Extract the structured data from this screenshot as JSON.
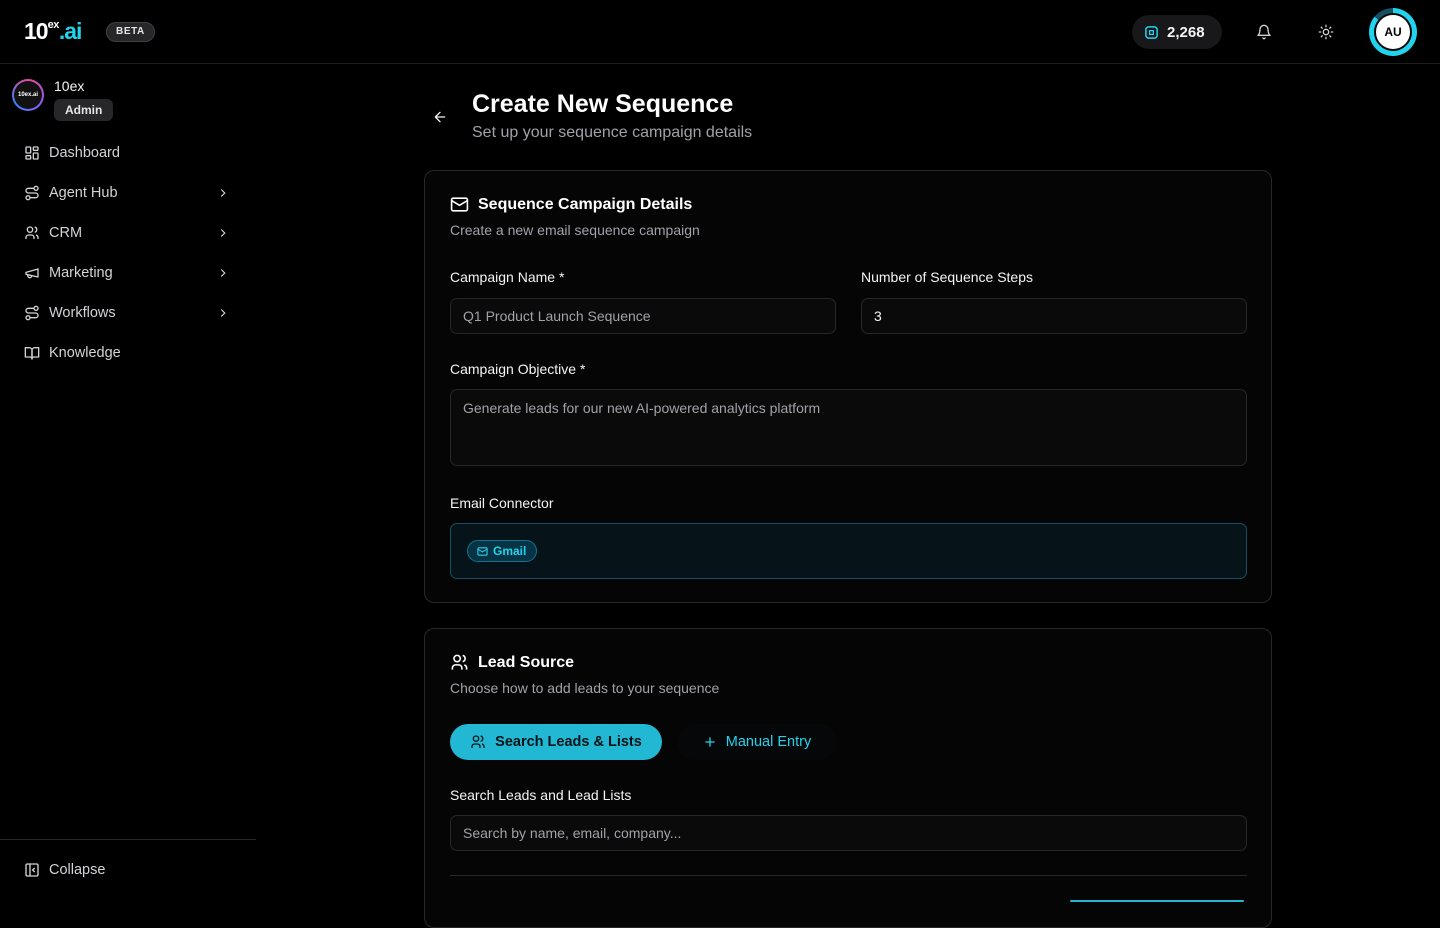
{
  "header": {
    "logo_main": "10",
    "logo_sup": "ex",
    "logo_suffix": ".ai",
    "beta_badge": "BETA",
    "credits": "2,268",
    "icons": [
      "coin-icon",
      "bell-icon",
      "sun-icon"
    ],
    "avatar_initials": "AU"
  },
  "sidebar": {
    "org_logo_text": "10ex.ai",
    "org_name": "10ex",
    "org_role": "Admin",
    "items": [
      {
        "label": "Dashboard",
        "icon": "grid-icon",
        "has_children": false
      },
      {
        "label": "Agent Hub",
        "icon": "route-icon",
        "has_children": true
      },
      {
        "label": "CRM",
        "icon": "users-icon",
        "has_children": true
      },
      {
        "label": "Marketing",
        "icon": "megaphone-icon",
        "has_children": true
      },
      {
        "label": "Workflows",
        "icon": "workflow-icon",
        "has_children": true
      },
      {
        "label": "Knowledge",
        "icon": "book-icon",
        "has_children": false
      }
    ],
    "collapse_label": "Collapse"
  },
  "page": {
    "title": "Create New Sequence",
    "subtitle": "Set up your sequence campaign details"
  },
  "details_card": {
    "title": "Sequence Campaign Details",
    "subtitle": "Create a new email sequence campaign",
    "campaign_name_label": "Campaign Name *",
    "campaign_name_placeholder": "Q1 Product Launch Sequence",
    "steps_label": "Number of Sequence Steps",
    "steps_value": "3",
    "objective_label": "Campaign Objective *",
    "objective_placeholder": "Generate leads for our new AI-powered analytics platform",
    "connector_label": "Email Connector",
    "connector_chip": "Gmail"
  },
  "lead_card": {
    "title": "Lead Source",
    "subtitle": "Choose how to add leads to your sequence",
    "search_button": "Search Leads & Lists",
    "manual_button": "Manual Entry",
    "search_label": "Search Leads and Lead Lists",
    "search_placeholder": "Search by name, email, company..."
  },
  "colors": {
    "accent": "#22b8d4",
    "accent_text": "#22d3ee",
    "background": "#000000",
    "border": "#27272a"
  }
}
